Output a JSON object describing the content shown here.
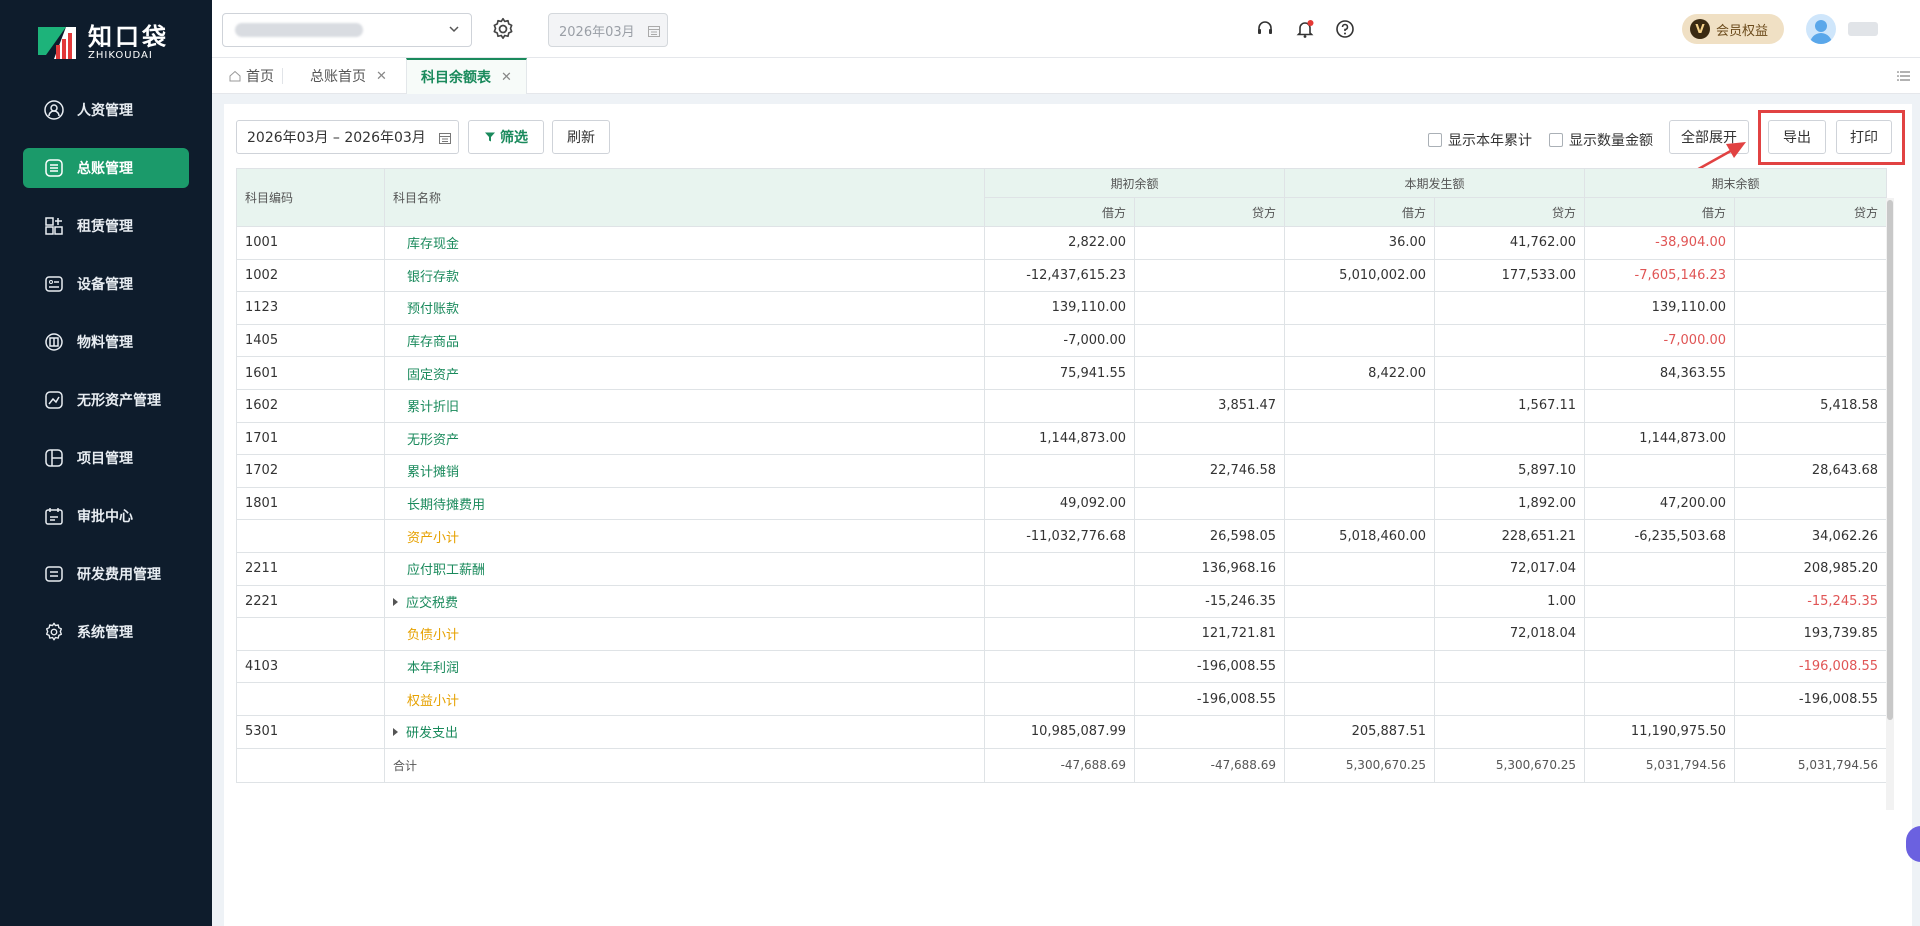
{
  "brand": {
    "name_cn": "知口袋",
    "name_en": "ZHIKOUDAI"
  },
  "sidebar": {
    "items": [
      {
        "label": "人资管理",
        "icon": "person-icon"
      },
      {
        "label": "总账管理",
        "icon": "ledger-icon",
        "active": true
      },
      {
        "label": "租赁管理",
        "icon": "lease-icon"
      },
      {
        "label": "设备管理",
        "icon": "device-icon"
      },
      {
        "label": "物料管理",
        "icon": "material-icon"
      },
      {
        "label": "无形资产管理",
        "icon": "intangible-icon"
      },
      {
        "label": "项目管理",
        "icon": "project-icon"
      },
      {
        "label": "审批中心",
        "icon": "approval-icon"
      },
      {
        "label": "研发费用管理",
        "icon": "rd-icon"
      },
      {
        "label": "系统管理",
        "icon": "gear-icon"
      }
    ]
  },
  "header": {
    "period": "2026年03月",
    "vip_label": "会员权益",
    "vip_badge": "V"
  },
  "tabs": [
    {
      "label": "首页",
      "closable": false
    },
    {
      "label": "总账首页",
      "closable": true
    },
    {
      "label": "科目余额表",
      "closable": true,
      "active": true
    }
  ],
  "toolbar": {
    "date_range": "2026年03月 – 2026年03月",
    "filter_label": "筛选",
    "refresh_label": "刷新",
    "show_year_total": "显示本年累计",
    "show_quantity": "显示数量金额",
    "expand_all": "全部展开",
    "export_label": "导出",
    "print_label": "打印"
  },
  "table": {
    "headers": {
      "code": "科目编码",
      "name": "科目名称",
      "opening": "期初余额",
      "period": "本期发生额",
      "closing": "期末余额",
      "debit": "借方",
      "credit": "贷方"
    },
    "rows": [
      {
        "code": "1001",
        "name": "库存现金",
        "type": "normal",
        "v": [
          "2,822.00",
          "",
          "36.00",
          "41,762.00",
          "-38,904.00",
          ""
        ]
      },
      {
        "code": "1002",
        "name": "银行存款",
        "type": "normal",
        "v": [
          "-12,437,615.23",
          "",
          "5,010,002.00",
          "177,533.00",
          "-7,605,146.23",
          ""
        ]
      },
      {
        "code": "1123",
        "name": "预付账款",
        "type": "normal",
        "v": [
          "139,110.00",
          "",
          "",
          "",
          "139,110.00",
          ""
        ]
      },
      {
        "code": "1405",
        "name": "库存商品",
        "type": "normal",
        "v": [
          "-7,000.00",
          "",
          "",
          "",
          "-7,000.00",
          ""
        ]
      },
      {
        "code": "1601",
        "name": "固定资产",
        "type": "normal",
        "v": [
          "75,941.55",
          "",
          "8,422.00",
          "",
          "84,363.55",
          ""
        ]
      },
      {
        "code": "1602",
        "name": "累计折旧",
        "type": "normal",
        "v": [
          "",
          "3,851.47",
          "",
          "1,567.11",
          "",
          "5,418.58"
        ]
      },
      {
        "code": "1701",
        "name": "无形资产",
        "type": "normal",
        "v": [
          "1,144,873.00",
          "",
          "",
          "",
          "1,144,873.00",
          ""
        ]
      },
      {
        "code": "1702",
        "name": "累计摊销",
        "type": "normal",
        "v": [
          "",
          "22,746.58",
          "",
          "5,897.10",
          "",
          "28,643.68"
        ]
      },
      {
        "code": "1801",
        "name": "长期待摊费用",
        "type": "normal",
        "v": [
          "49,092.00",
          "",
          "",
          "1,892.00",
          "47,200.00",
          ""
        ]
      },
      {
        "code": "",
        "name": "资产小计",
        "type": "subtotal",
        "v": [
          "-11,032,776.68",
          "26,598.05",
          "5,018,460.00",
          "228,651.21",
          "-6,235,503.68",
          "34,062.26"
        ]
      },
      {
        "code": "2211",
        "name": "应付职工薪酬",
        "type": "normal",
        "v": [
          "",
          "136,968.16",
          "",
          "72,017.04",
          "",
          "208,985.20"
        ]
      },
      {
        "code": "2221",
        "name": "应交税费",
        "type": "normal",
        "expandable": true,
        "v": [
          "",
          "-15,246.35",
          "",
          "1.00",
          "",
          "-15,245.35"
        ]
      },
      {
        "code": "",
        "name": "负债小计",
        "type": "subtotal",
        "v": [
          "",
          "121,721.81",
          "",
          "72,018.04",
          "",
          "193,739.85"
        ]
      },
      {
        "code": "4103",
        "name": "本年利润",
        "type": "normal",
        "v": [
          "",
          "-196,008.55",
          "",
          "",
          "",
          "-196,008.55"
        ]
      },
      {
        "code": "",
        "name": "权益小计",
        "type": "subtotal",
        "v": [
          "",
          "-196,008.55",
          "",
          "",
          "",
          "-196,008.55"
        ]
      },
      {
        "code": "5301",
        "name": "研发支出",
        "type": "normal",
        "expandable": true,
        "v": [
          "10,985,087.99",
          "",
          "205,887.51",
          "",
          "11,190,975.50",
          ""
        ]
      }
    ],
    "total": {
      "label": "合计",
      "v": [
        "-47,688.69",
        "-47,688.69",
        "5,300,670.25",
        "5,300,670.25",
        "5,031,794.56",
        "5,031,794.56"
      ]
    }
  },
  "colors": {
    "accent": "#1a8a5c",
    "sidebar_bg": "#0e1c2c",
    "negative": "#e05555",
    "subtotal": "#e6a100",
    "highlight": "#e14242"
  }
}
